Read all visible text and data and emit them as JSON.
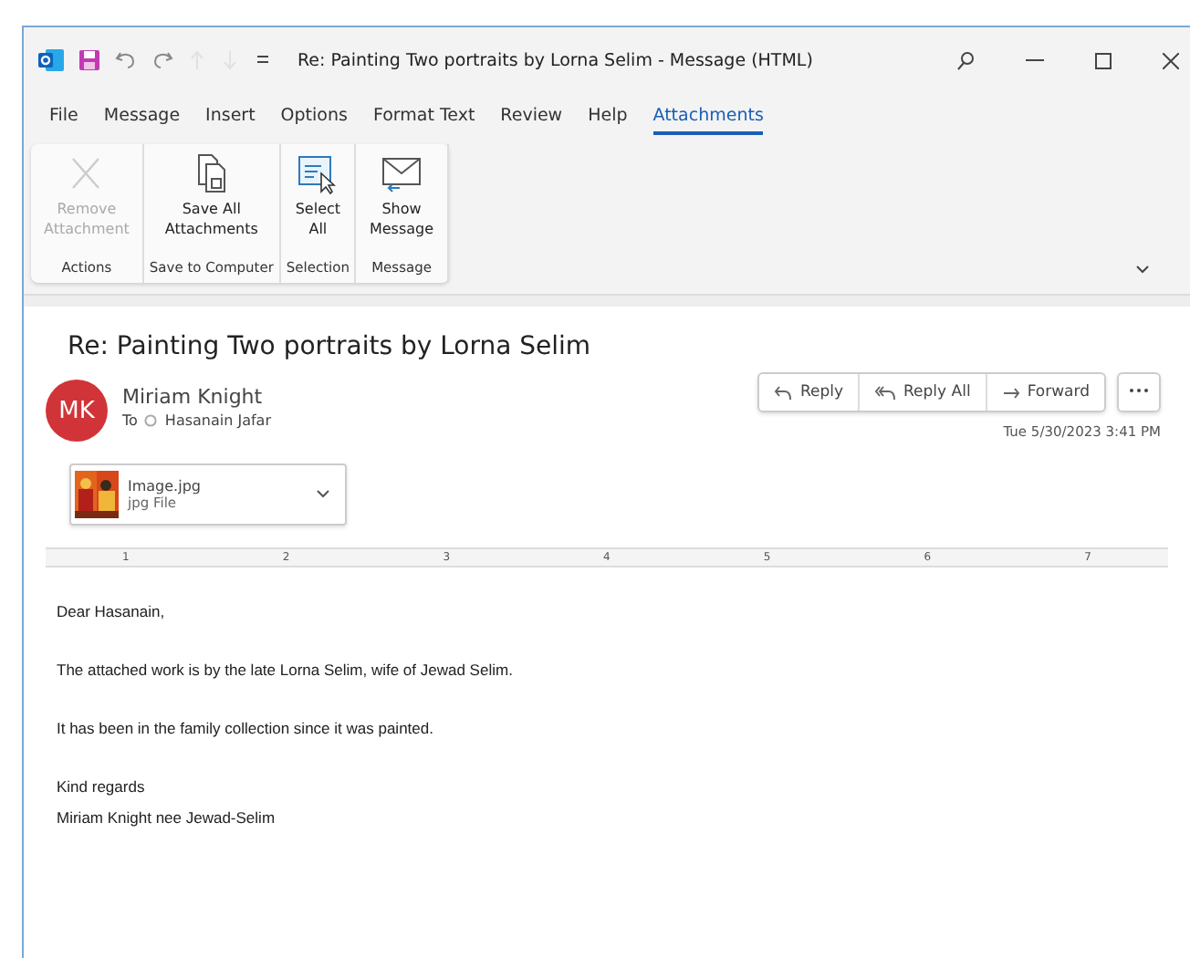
{
  "window": {
    "title": "Re: Painting Two portraits by Lorna Selim - Message (HTML)",
    "quick_access": [
      {
        "kind": "outlook",
        "disabled": false
      },
      {
        "kind": "save",
        "disabled": false
      },
      {
        "kind": "undo",
        "disabled": false
      },
      {
        "kind": "redo",
        "disabled": false
      },
      {
        "kind": "up",
        "disabled": true
      },
      {
        "kind": "down",
        "disabled": true
      },
      {
        "kind": "customize",
        "disabled": false
      }
    ]
  },
  "menu_tabs": [
    {
      "label": "File",
      "selected": false
    },
    {
      "label": "Message",
      "selected": false
    },
    {
      "label": "Insert",
      "selected": false
    },
    {
      "label": "Options",
      "selected": false
    },
    {
      "label": "Format Text",
      "selected": false
    },
    {
      "label": "Review",
      "selected": false
    },
    {
      "label": "Help",
      "selected": false
    },
    {
      "label": "Attachments",
      "selected": true
    }
  ],
  "ribbon": [
    {
      "group": "Actions",
      "buttons": [
        {
          "kind": "remove",
          "lines": [
            "Remove",
            "Attachment"
          ],
          "disabled": true
        }
      ]
    },
    {
      "group": "Save to Computer",
      "buttons": [
        {
          "kind": "save_all",
          "lines": [
            "Save All",
            "Attachments"
          ],
          "disabled": false
        }
      ]
    },
    {
      "group": "Selection",
      "buttons": [
        {
          "kind": "select_all",
          "lines": [
            "Select",
            "All"
          ],
          "disabled": false
        }
      ]
    },
    {
      "group": "Message",
      "buttons": [
        {
          "kind": "show_message",
          "lines": [
            "Show",
            "Message"
          ],
          "disabled": false
        }
      ]
    }
  ],
  "message": {
    "subject": "Re: Painting Two portraits by Lorna Selim",
    "sender": {
      "initials": "MK",
      "name": "Miriam Knight"
    },
    "to_label": "To",
    "recipient": "Hasanain Jafar",
    "date": "Tue 5/30/2023 3:41 PM",
    "actions": [
      {
        "kind": "reply",
        "label": "Reply"
      },
      {
        "kind": "reply_all",
        "label": "Reply All"
      },
      {
        "kind": "forward",
        "label": "Forward"
      }
    ],
    "attachment": {
      "name": "Image.jpg",
      "type": "jpg File"
    },
    "ruler": [
      "1",
      "2",
      "3",
      "4",
      "5",
      "6",
      "7"
    ],
    "body": [
      [
        "Dear Hasanain,"
      ],
      [
        "The attached work is by the late Lorna Selim, wife of Jewad Selim."
      ],
      [
        "It has been in the family collection since it was painted."
      ],
      [
        "Kind regards",
        "Miriam Knight nee Jewad-Selim"
      ]
    ]
  }
}
